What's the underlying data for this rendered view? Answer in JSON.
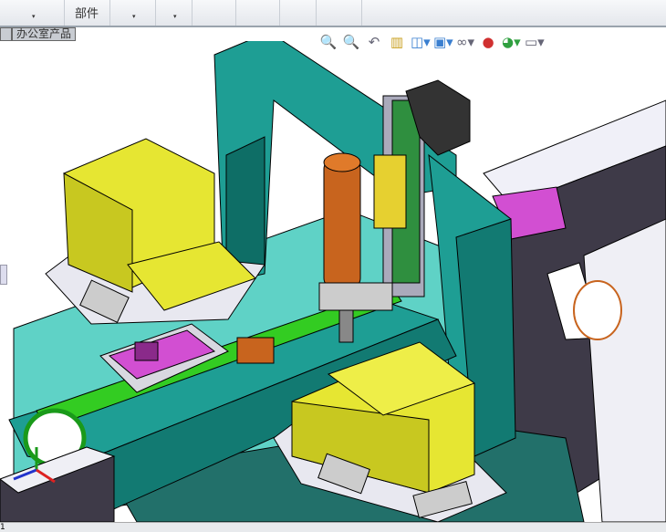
{
  "ribbon": {
    "groups": [
      {
        "label": ""
      },
      {
        "label": "部件"
      },
      {
        "label": ""
      },
      {
        "label": ""
      },
      {
        "label": ""
      },
      {
        "label": ""
      },
      {
        "label": ""
      },
      {
        "label": ""
      }
    ]
  },
  "tabs": [
    {
      "label": ""
    },
    {
      "label": "办公室产品"
    }
  ],
  "hud": {
    "icons": [
      "zoom-to-fit-icon",
      "zoom-to-area-icon",
      "previous-view-icon",
      "section-view-icon",
      "view-orientation-icon",
      "display-style-icon",
      "hide-show-items-icon",
      "edit-appearance-icon",
      "apply-scene-icon",
      "view-settings-icon"
    ]
  },
  "status": {
    "text": "1"
  },
  "colors": {
    "frame": "#1e9e94",
    "yellow": "#e6e632",
    "belt": "#33cc22",
    "magenta": "#d24fd2",
    "orange": "#c8641e",
    "dark": "#3e3a48"
  }
}
